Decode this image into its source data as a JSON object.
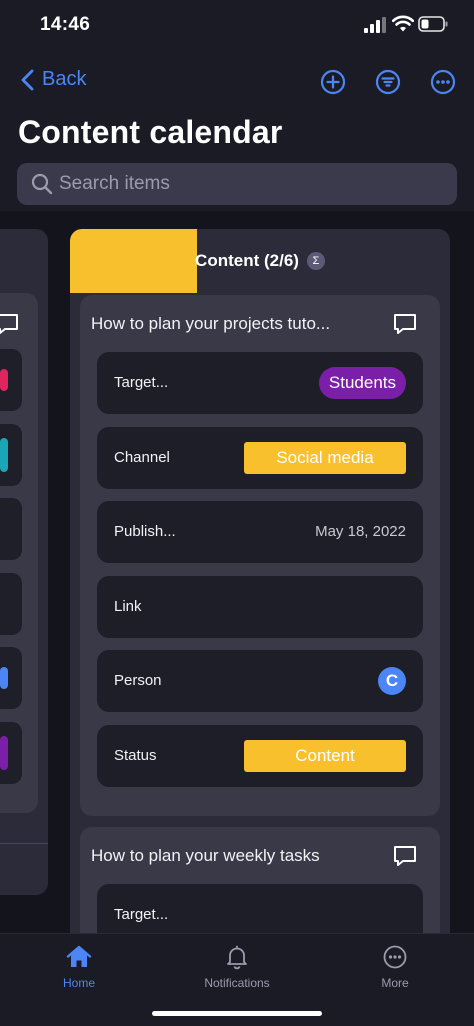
{
  "status_bar": {
    "time": "14:46"
  },
  "nav": {
    "back_label": "Back"
  },
  "page": {
    "title": "Content calendar"
  },
  "search": {
    "placeholder": "Search items"
  },
  "board": {
    "column": {
      "title": "Content (2/6)",
      "sigma": "Σ",
      "progress_fraction": 0.333
    },
    "cards": [
      {
        "title": "How to plan your projects tuto...",
        "fields": [
          {
            "label": "Target...",
            "value": "Students"
          },
          {
            "label": "Channel",
            "value": "Social media"
          },
          {
            "label": "Publish...",
            "value": "May 18, 2022"
          },
          {
            "label": "Link",
            "value": ""
          },
          {
            "label": "Person",
            "value": "C"
          },
          {
            "label": "Status",
            "value": "Content"
          }
        ]
      },
      {
        "title": "How to plan your weekly tasks",
        "fields": [
          {
            "label": "Target...",
            "value": ""
          }
        ]
      }
    ]
  },
  "tabs": [
    {
      "label": "Home",
      "active": true
    },
    {
      "label": "Notifications",
      "active": false
    },
    {
      "label": "More",
      "active": false
    }
  ],
  "colors": {
    "accent": "#4c86f5",
    "yellow": "#f8c02c",
    "purple": "#7c1fa8",
    "background": "#1b1b26"
  }
}
